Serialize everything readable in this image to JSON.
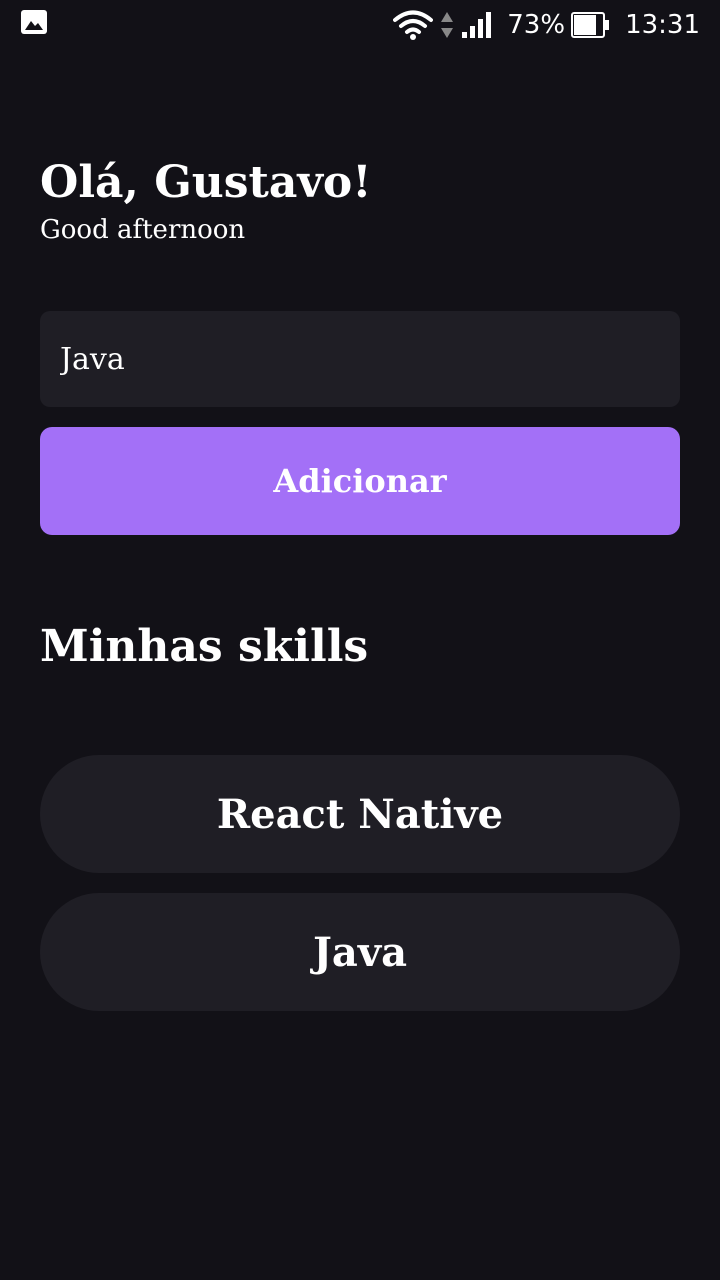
{
  "status_bar": {
    "left_icon": "image-icon",
    "icons": [
      "wifi-icon",
      "data-transfer-icon",
      "signal-icon",
      "battery-icon"
    ],
    "battery_percent": "73%",
    "time": "13:31"
  },
  "header": {
    "greeting": "Olá, Gustavo!",
    "subtitle": "Good afternoon"
  },
  "form": {
    "input_value": "Java",
    "button_label": "Adicionar"
  },
  "skills_section": {
    "title": "Minhas skills",
    "items": [
      {
        "label": "React Native"
      },
      {
        "label": "Java"
      }
    ]
  },
  "colors": {
    "background": "#121117",
    "card": "#1f1e25",
    "accent": "#a370f7",
    "text": "#ffffff"
  }
}
